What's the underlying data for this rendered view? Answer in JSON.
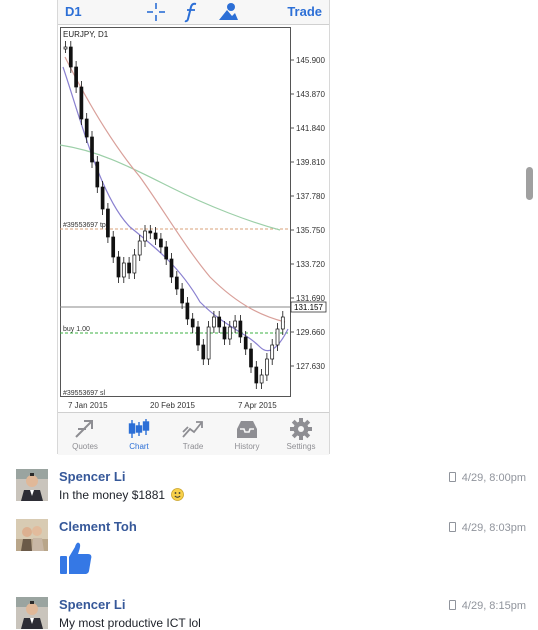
{
  "toolbar": {
    "timeframe": "D1",
    "trade_label": "Trade"
  },
  "chart": {
    "symbol_label": "EURJPY, D1",
    "price_labels": [
      "145.900",
      "143.870",
      "141.840",
      "139.810",
      "137.780",
      "135.750",
      "133.720",
      "131.690",
      "129.660",
      "127.630"
    ],
    "current_price": "131.157",
    "date_labels": [
      "7 Jan 2015",
      "20 Feb 2015",
      "7 Apr 2015"
    ],
    "order_tp_label": "#39553697 tp",
    "order_buy_label": "buy 1.00",
    "order_sl_label": "#39553697 sl",
    "colors": {
      "tp_line": "#d9a07a",
      "buy_line": "#3cb043",
      "current_line": "#8a8a8a",
      "ma_red": "#d9a09a",
      "ma_green": "#9ccfa8",
      "ma_purple": "#8a80d0"
    }
  },
  "tabs": [
    {
      "label": "Quotes",
      "icon": "quotes-icon"
    },
    {
      "label": "Chart",
      "icon": "chart-icon"
    },
    {
      "label": "Trade",
      "icon": "trade-icon"
    },
    {
      "label": "History",
      "icon": "history-icon"
    },
    {
      "label": "Settings",
      "icon": "gear-icon"
    }
  ],
  "comments": [
    {
      "author": "Spencer Li",
      "text": "In the money $1881",
      "time": "4/29, 8:00pm"
    },
    {
      "author": "Clement Toh",
      "text": "",
      "time": "4/29, 8:03pm",
      "sticker": "thumbs-up-icon"
    },
    {
      "author": "Spencer Li",
      "text": "My most productive ICT lol",
      "time": "4/29, 8:15pm"
    }
  ]
}
